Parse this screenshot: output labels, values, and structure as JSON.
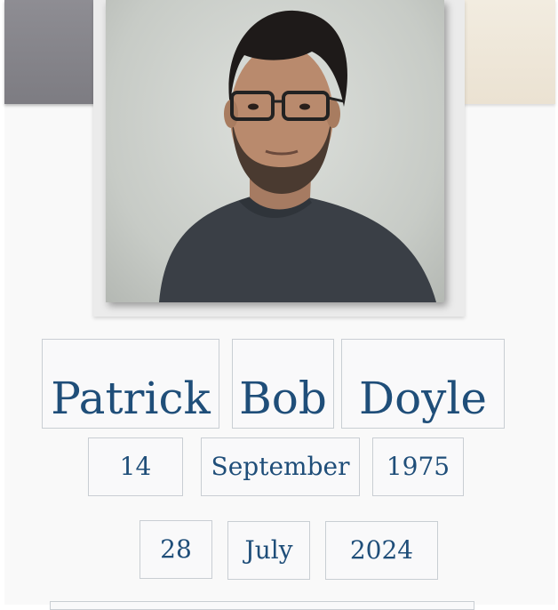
{
  "person": {
    "photo_icon": "portrait-photo",
    "first_name": "Patrick",
    "middle_name": "Bob",
    "last_name": "Doyle"
  },
  "birth_date": {
    "day": "14",
    "month": "September",
    "year": "1975"
  },
  "second_date": {
    "day": "28",
    "month": "July",
    "year": "2024"
  },
  "colors": {
    "text": "#1f4e79",
    "field_border": "#c9ced3",
    "background": "#f9f9f9"
  }
}
